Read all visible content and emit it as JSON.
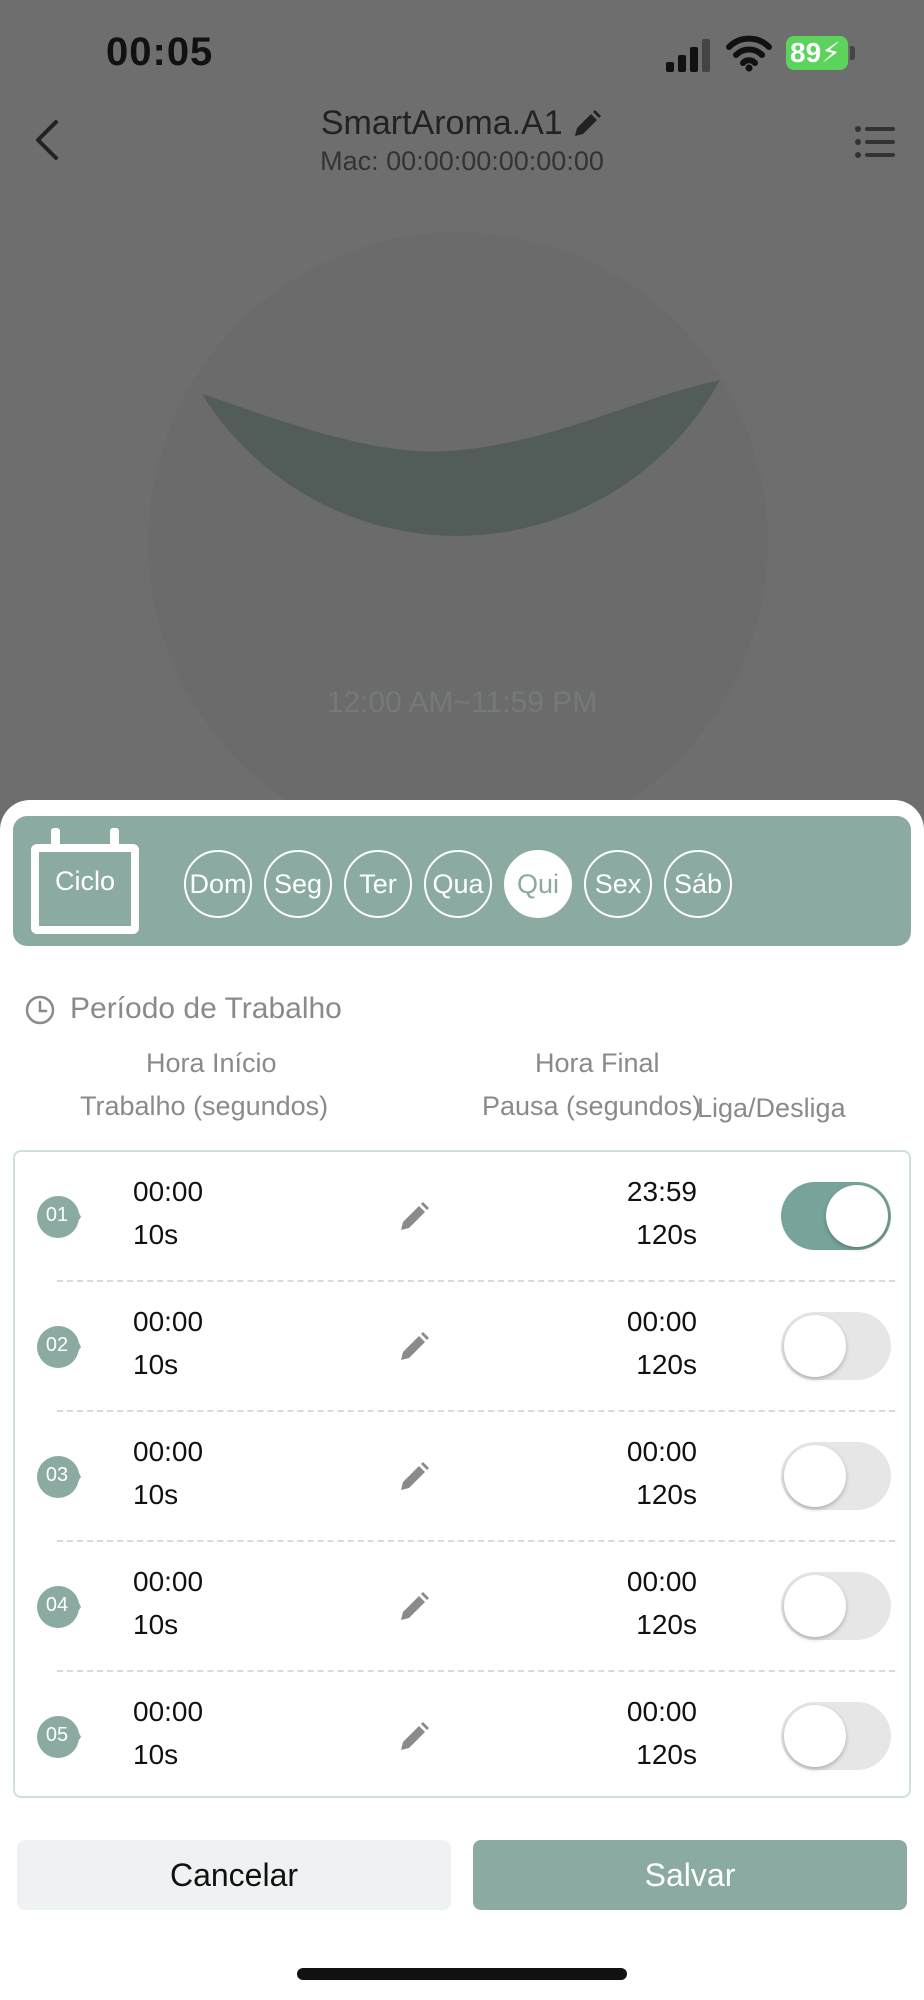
{
  "status_bar": {
    "time": "00:05",
    "battery": "89"
  },
  "header": {
    "device_name": "SmartAroma.A1",
    "mac_label": "Mac:",
    "mac_value": "00:00:00:00:00:00"
  },
  "dial": {
    "time_range": "12:00 AM~11:59 PM"
  },
  "week": {
    "cycle_label": "Ciclo",
    "days": [
      {
        "label": "Dom",
        "selected": false
      },
      {
        "label": "Seg",
        "selected": false
      },
      {
        "label": "Ter",
        "selected": false
      },
      {
        "label": "Qua",
        "selected": false
      },
      {
        "label": "Qui",
        "selected": true
      },
      {
        "label": "Sex",
        "selected": false
      },
      {
        "label": "Sáb",
        "selected": false
      }
    ]
  },
  "section": {
    "title": "Período de Trabalho"
  },
  "columns": {
    "start_time": "Hora Início",
    "work_seconds": "Trabalho (segundos)",
    "end_time": "Hora Final",
    "pause_seconds": "Pausa (segundos)",
    "on_off": "Liga/Desliga"
  },
  "periods": [
    {
      "index": "01",
      "start": "00:00",
      "work": "10s",
      "end": "23:59",
      "pause": "120s",
      "enabled": true
    },
    {
      "index": "02",
      "start": "00:00",
      "work": "10s",
      "end": "00:00",
      "pause": "120s",
      "enabled": false
    },
    {
      "index": "03",
      "start": "00:00",
      "work": "10s",
      "end": "00:00",
      "pause": "120s",
      "enabled": false
    },
    {
      "index": "04",
      "start": "00:00",
      "work": "10s",
      "end": "00:00",
      "pause": "120s",
      "enabled": false
    },
    {
      "index": "05",
      "start": "00:00",
      "work": "10s",
      "end": "00:00",
      "pause": "120s",
      "enabled": false
    }
  ],
  "actions": {
    "cancel": "Cancelar",
    "save": "Salvar"
  },
  "colors": {
    "accent": "#8aaaa2",
    "toggle_on": "#78a39a",
    "dim_overlay": "#6e6e6e",
    "battery": "#5bd35c"
  }
}
